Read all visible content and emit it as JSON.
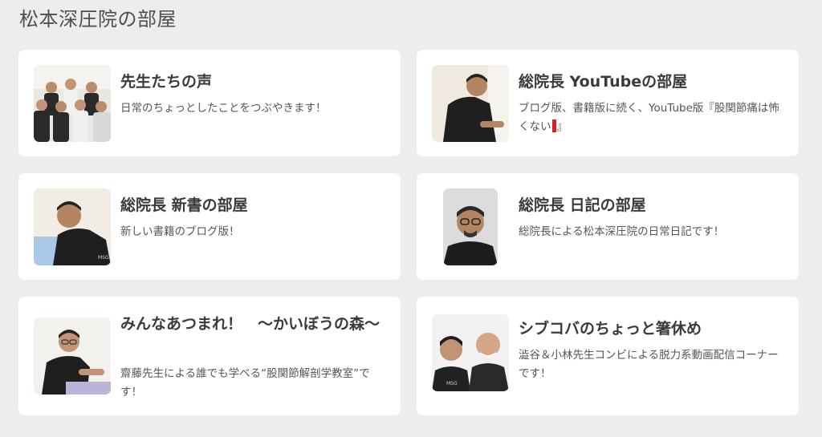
{
  "page": {
    "title": "松本深圧院の部屋"
  },
  "cards": [
    {
      "title": "先生たちの声",
      "description": "日常のちょっとしたことをつぶやきます！",
      "thumbnail": "staff-group-photo"
    },
    {
      "title": "総院長 YouTubeの部屋",
      "description_a": "ブログ版、書籍版に続く、YouTube版『股関節痛は怖くない",
      "description_b": "』",
      "thumbnail": "director-treating-photo"
    },
    {
      "title": "総院長 新書の部屋",
      "description": "新しい書籍のブログ版！",
      "thumbnail": "director-at-work-photo"
    },
    {
      "title": "総院長 日記の部屋",
      "description": "総院長による松本深圧院の日常日記です！",
      "thumbnail": "director-portrait-photo"
    },
    {
      "title": "みんなあつまれ！　～かいぼうの森～",
      "description": "齋藤先生による誰でも学べる“股関節解剖学教室”です！",
      "thumbnail": "saito-treating-photo"
    },
    {
      "title": "シブコバのちょっと箸休め",
      "description": "澁谷＆小林先生コンビによる脱力系動画配信コーナーです！",
      "thumbnail": "shibuya-kobayashi-photo"
    }
  ],
  "colors": {
    "background": "#ededed",
    "card": "#ffffff",
    "title_text": "#3a3a3a",
    "description_text": "#555555",
    "accent_red": "#d81e1e"
  }
}
